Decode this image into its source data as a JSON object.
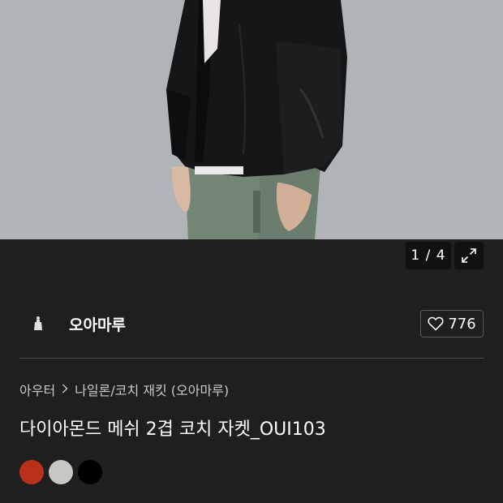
{
  "gallery": {
    "counter": "1 / 4",
    "expand_icon": "expand-arrows-icon"
  },
  "brand": {
    "name": "오아마루",
    "logo_icon": "brand-logo-icon",
    "likes": "776",
    "like_icon": "heart-outline-icon"
  },
  "breadcrumb": {
    "category": "아우터",
    "separator_icon": "chevron-right-icon",
    "subcategory": "나일론/코치 재킷 (오아마루)"
  },
  "product": {
    "title": "다이아몬드 메쉬 2겹 코치 자켓_OUI103"
  },
  "color_options": [
    {
      "name": "red",
      "hex": "#b8321a"
    },
    {
      "name": "light-gray",
      "hex": "#c8c7c2"
    },
    {
      "name": "black",
      "hex": "#000000"
    }
  ],
  "colors": {
    "background": "#1f1f1f",
    "text": "#ffffff",
    "muted_text": "#c9c9c9",
    "divider": "#4a4a4a"
  }
}
